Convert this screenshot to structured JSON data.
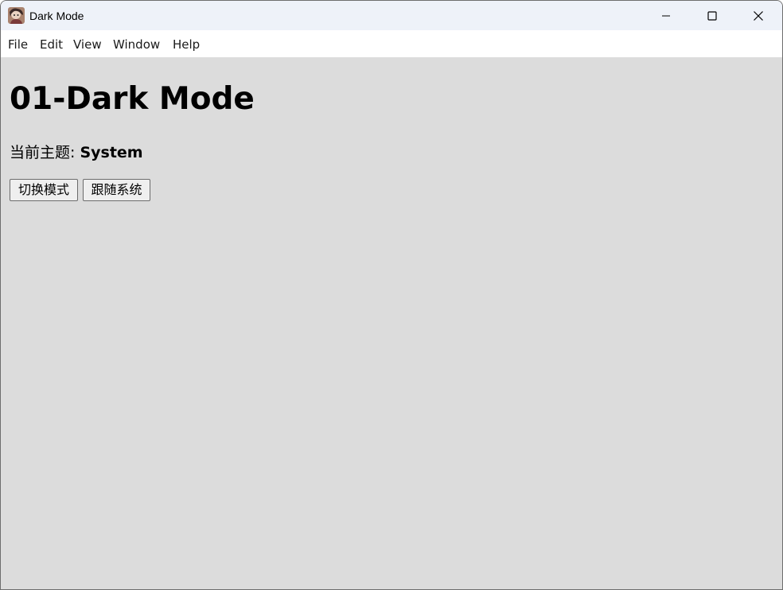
{
  "window": {
    "title": "Dark Mode",
    "app_icon": "app-avatar-icon",
    "controls": {
      "minimize_icon": "minimize-icon",
      "maximize_icon": "maximize-icon",
      "close_icon": "close-icon"
    }
  },
  "menubar": {
    "items": [
      {
        "label": "File"
      },
      {
        "label": "Edit"
      },
      {
        "label": "View"
      },
      {
        "label": "Window"
      },
      {
        "label": "Help"
      }
    ]
  },
  "main": {
    "heading": "01-Dark Mode",
    "theme_label": "当前主题: ",
    "theme_value": "System",
    "buttons": {
      "toggle_label": "切换模式",
      "system_label": "跟随系统"
    }
  },
  "colors": {
    "content_background": "#dcdcdc",
    "titlebar_background": "#eef2f9",
    "menubar_background": "#ffffff"
  }
}
